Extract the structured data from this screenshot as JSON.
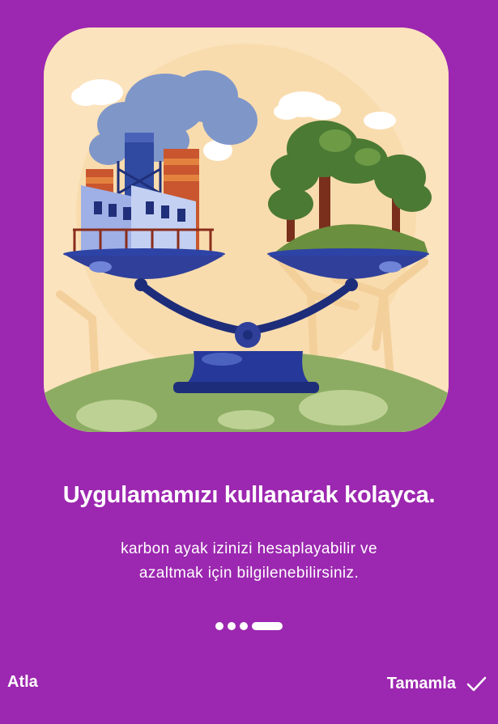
{
  "onboarding": {
    "title": "Uygulamamızı kullanarak kolayca.",
    "description": "karbon ayak izinizi hesaplayabilir ve azaltmak için bilgilenebilirsiniz.",
    "page_indicator": {
      "total": 4,
      "current": 4
    }
  },
  "footer": {
    "skip_label": "Atla",
    "done_label": "Tamamla",
    "done_icon": "check-icon"
  },
  "colors": {
    "background": "#9c27b0",
    "text": "#ffffff"
  },
  "illustration": {
    "subject": "balance-scale-factory-vs-trees"
  }
}
